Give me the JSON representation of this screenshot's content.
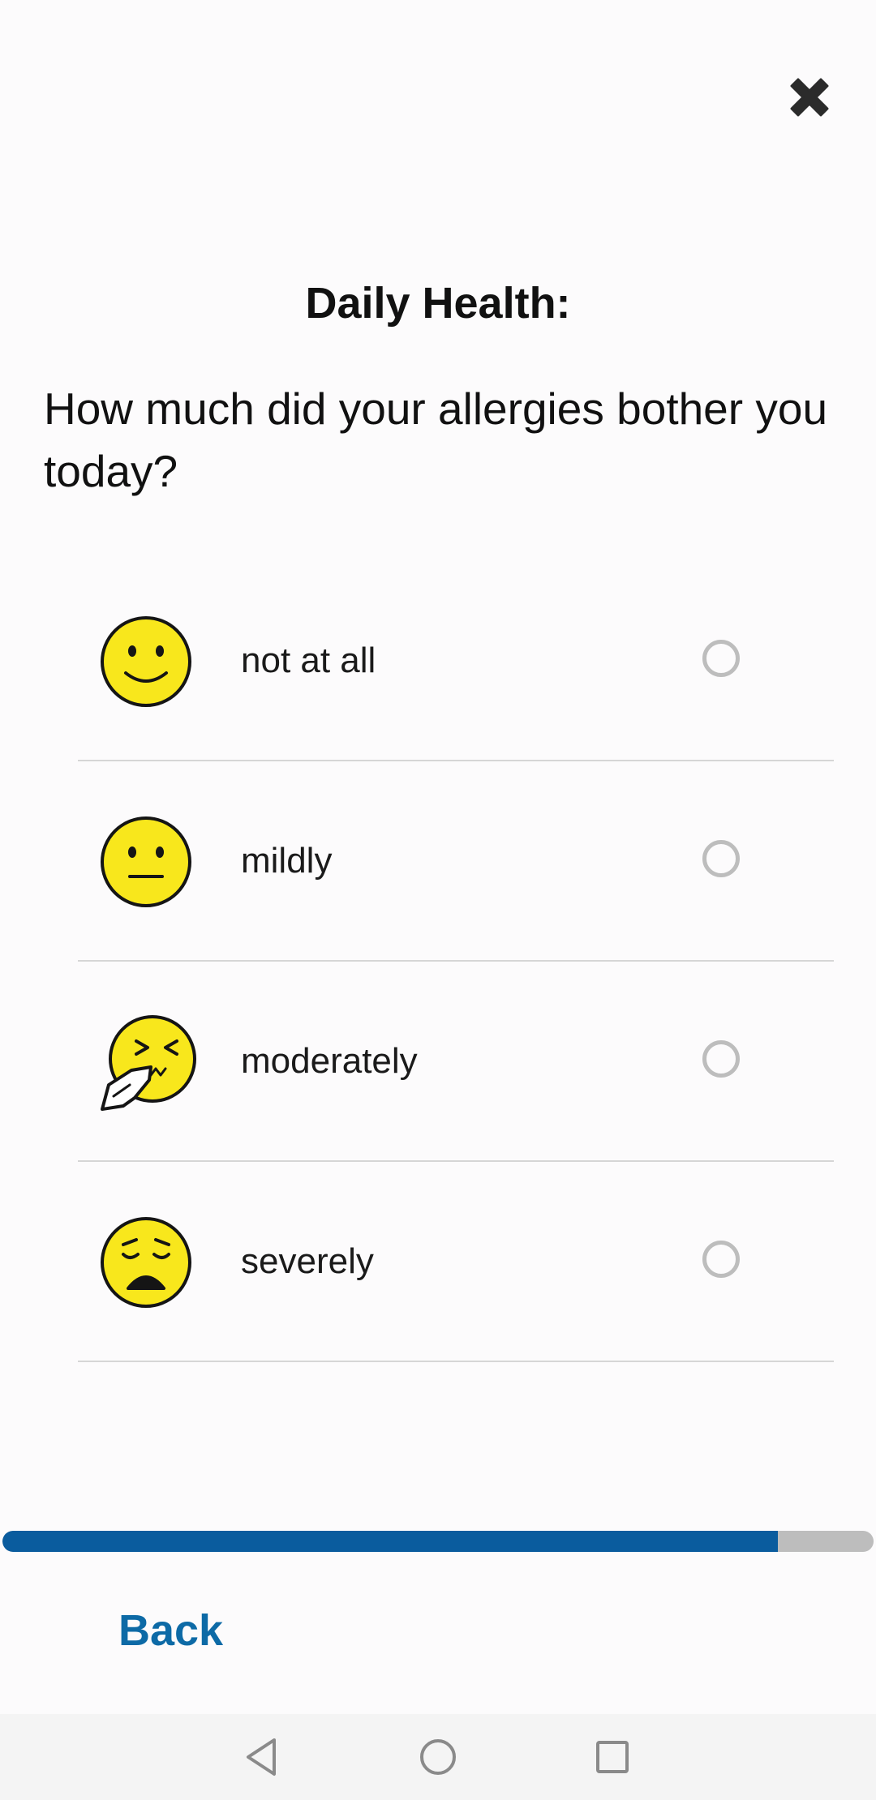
{
  "header": {
    "close_icon": "close-icon"
  },
  "survey": {
    "title": "Daily Health:",
    "question": "How much did your allergies bother you today?",
    "options": [
      {
        "label": "not at all",
        "icon": "slightly-smiling-face-icon",
        "selected": false
      },
      {
        "label": "mildly",
        "icon": "neutral-face-icon",
        "selected": false
      },
      {
        "label": "moderately",
        "icon": "sneezing-face-icon",
        "selected": false
      },
      {
        "label": "severely",
        "icon": "weary-face-icon",
        "selected": false
      }
    ]
  },
  "progress": {
    "value": 0.89,
    "fill_color": "#0a5c9e",
    "track_color": "#bdbdbd"
  },
  "footer": {
    "back_label": "Back",
    "accent_color": "#0d6aa6"
  },
  "system_nav": {
    "buttons": [
      "back-triangle-icon",
      "home-circle-icon",
      "recents-square-icon"
    ]
  }
}
